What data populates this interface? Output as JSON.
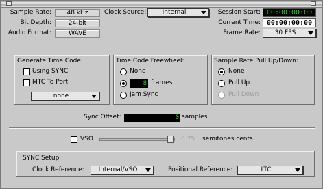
{
  "session_info": {
    "sample_rate_label": "Sample Rate:",
    "sample_rate_value": "48 kHz",
    "bit_depth_label": "Bit Depth:",
    "bit_depth_value": "24-bit",
    "audio_format_label": "Audio Format:",
    "audio_format_value": "WAVE",
    "clock_source_label": "Clock Source:",
    "clock_source_value": "Internal",
    "session_start_label": "Session Start:",
    "session_start_value": "00:00:00:00",
    "current_time_label": "Current Time:",
    "current_time_value": "00:00:00:00",
    "frame_rate_label": "Frame Rate:",
    "frame_rate_value": "30 FPS"
  },
  "generate_time_code": {
    "title": "Generate Time Code:",
    "using_sync_label": "Using SYNC",
    "using_sync_checked": false,
    "mtc_label": "MTC To Port:",
    "mtc_checked": false,
    "port_value": "none"
  },
  "freewheel": {
    "title": "Time Code Freewheel:",
    "none_label": "None",
    "frames_value": "8",
    "frames_label": "frames",
    "jam_sync_label": "Jam Sync",
    "selected": "frames"
  },
  "pull": {
    "title": "Sample Rate Pull Up/Down:",
    "none_label": "None",
    "pull_up_label": "Pull Up",
    "pull_down_label": "Pull Down",
    "selected": "None"
  },
  "sync_offset": {
    "label": "Sync Offset:",
    "value": "0",
    "unit": "samples"
  },
  "vso": {
    "label": "VSO",
    "checked": false,
    "value": "0.75",
    "unit": "semitones.cents"
  },
  "sync_setup": {
    "title": "SYNC Setup",
    "clock_ref_label": "Clock Reference:",
    "clock_ref_value": "Internal/VSO",
    "positional_ref_label": "Positional Reference:",
    "positional_ref_value": "LTC"
  }
}
